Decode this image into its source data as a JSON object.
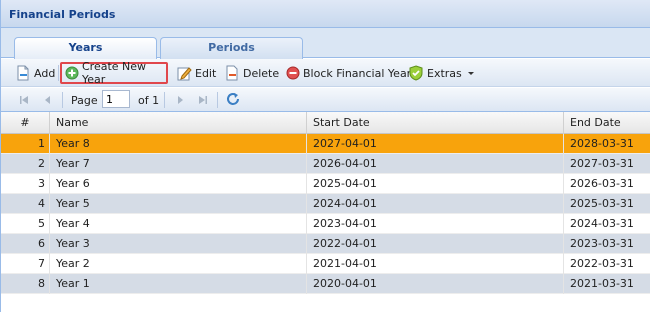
{
  "panel": {
    "title": "Financial Periods"
  },
  "tabs": [
    {
      "label": "Years",
      "active": true
    },
    {
      "label": "Periods",
      "active": false
    }
  ],
  "toolbar": {
    "add_label": "Add",
    "create_label": "Create New Year",
    "edit_label": "Edit",
    "delete_label": "Delete",
    "block_label": "Block Financial Year",
    "extras_label": "Extras"
  },
  "pager": {
    "page_label": "Page",
    "page_value": "1",
    "of_label": "of 1"
  },
  "columns": {
    "num": "#",
    "name": "Name",
    "start": "Start Date",
    "end": "End Date"
  },
  "rows": [
    {
      "num": "1",
      "name": "Year 8",
      "start": "2027-04-01",
      "end": "2028-03-31"
    },
    {
      "num": "2",
      "name": "Year 7",
      "start": "2026-04-01",
      "end": "2027-03-31"
    },
    {
      "num": "3",
      "name": "Year 6",
      "start": "2025-04-01",
      "end": "2026-03-31"
    },
    {
      "num": "4",
      "name": "Year 5",
      "start": "2024-04-01",
      "end": "2025-03-31"
    },
    {
      "num": "5",
      "name": "Year 4",
      "start": "2023-04-01",
      "end": "2024-03-31"
    },
    {
      "num": "6",
      "name": "Year 3",
      "start": "2022-04-01",
      "end": "2023-03-31"
    },
    {
      "num": "7",
      "name": "Year 2",
      "start": "2021-04-01",
      "end": "2022-03-31"
    },
    {
      "num": "8",
      "name": "Year 1",
      "start": "2020-04-01",
      "end": "2021-03-31"
    }
  ],
  "colors": {
    "selected_row": "#f8a30c",
    "alt_row": "#d5dce6",
    "highlight_border": "#e0474c",
    "title_text": "#15428b"
  }
}
